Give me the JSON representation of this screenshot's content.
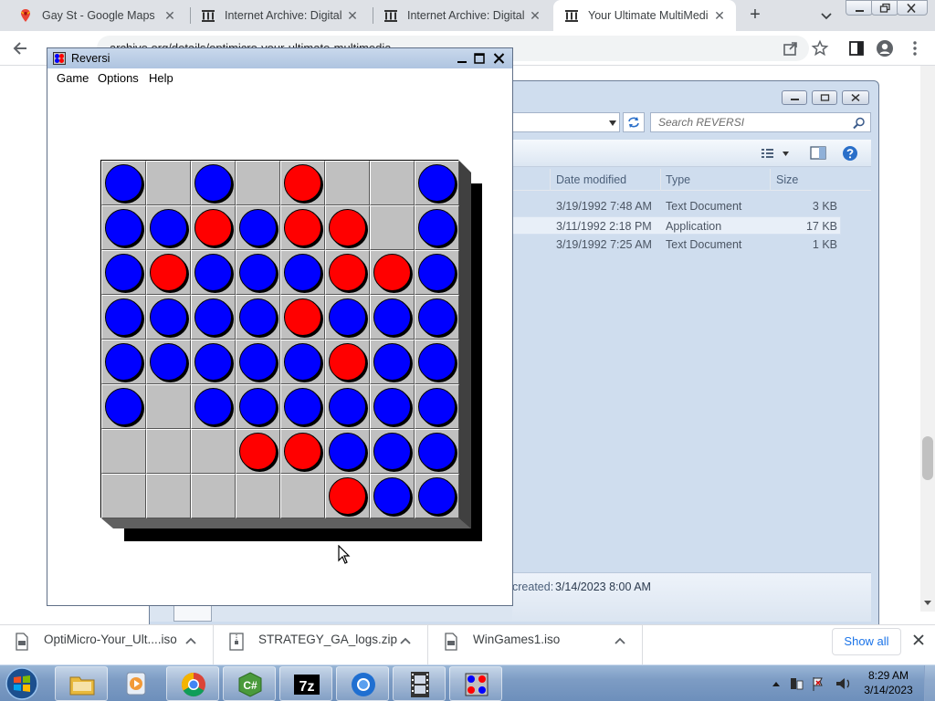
{
  "browser": {
    "tabs": [
      {
        "title": "Gay St - Google Maps",
        "favicon": "google-maps-pin-icon",
        "active": false
      },
      {
        "title": "Internet Archive: Digital L",
        "favicon": "internet-archive-icon",
        "active": false
      },
      {
        "title": "Internet Archive: Digital L",
        "favicon": "internet-archive-icon",
        "active": false
      },
      {
        "title": "Your Ultimate MultiMedia",
        "favicon": "internet-archive-icon",
        "active": true
      }
    ],
    "address": "archive.org/details/optimicro-your-ultimate-multimedia"
  },
  "explorer": {
    "search_placeholder": "Search REVERSI",
    "columns": {
      "date": "Date modified",
      "type": "Type",
      "size": "Size"
    },
    "files": [
      {
        "date": "3/19/1992 7:48 AM",
        "type": "Text Document",
        "size": "3 KB",
        "selected": false
      },
      {
        "date": "3/11/1992 2:18 PM",
        "type": "Application",
        "size": "17 KB",
        "selected": true
      },
      {
        "date": "3/19/1992 7:25 AM",
        "type": "Text Document",
        "size": "1 KB",
        "selected": false
      }
    ],
    "details": {
      "created_label": "created:",
      "created_value": "3/14/2023 8:00 AM"
    }
  },
  "reversi": {
    "title": "Reversi",
    "menu": [
      "Game",
      "Options",
      "Help"
    ],
    "colors": {
      "blue": "#0000ff",
      "red": "#ff0000",
      "cell": "#c0c0c0"
    },
    "board": [
      [
        "B",
        ".",
        "B",
        ".",
        "R",
        ".",
        ".",
        "B"
      ],
      [
        "B",
        "B",
        "R",
        "B",
        "R",
        "R",
        ".",
        "B"
      ],
      [
        "B",
        "R",
        "B",
        "B",
        "B",
        "R",
        "R",
        "B"
      ],
      [
        "B",
        "B",
        "B",
        "B",
        "R",
        "B",
        "B",
        "B"
      ],
      [
        "B",
        "B",
        "B",
        "B",
        "B",
        "R",
        "B",
        "B"
      ],
      [
        "B",
        ".",
        "B",
        "B",
        "B",
        "B",
        "B",
        "B"
      ],
      [
        ".",
        ".",
        ".",
        "R",
        "R",
        "B",
        "B",
        "B"
      ],
      [
        ".",
        ".",
        ".",
        ".",
        ".",
        "R",
        "B",
        "B"
      ]
    ]
  },
  "downloads": {
    "items": [
      {
        "name": "OptiMicro-Your_Ult....iso",
        "icon": "iso-file-icon"
      },
      {
        "name": "STRATEGY_GA_logs.zip",
        "icon": "zip-file-icon"
      },
      {
        "name": "WinGames1.iso",
        "icon": "iso-file-icon"
      }
    ],
    "show_all": "Show all"
  },
  "taskbar": {
    "apps": [
      "windows-explorer-icon",
      "media-player-icon",
      "chrome-icon",
      "csharp-icon",
      "7zip-icon",
      "chrome-canary-icon",
      "film-strip-icon",
      "reversi-icon"
    ],
    "time": "8:29 AM",
    "date": "3/14/2023"
  }
}
